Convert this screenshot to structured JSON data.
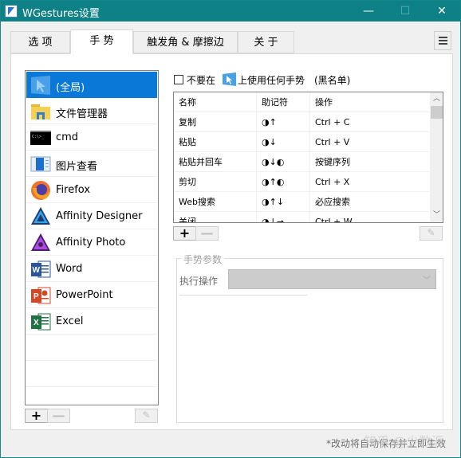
{
  "window": {
    "title": "WGestures设置",
    "controls": {
      "minimize": "—",
      "maximize": "☐",
      "close": "✕"
    }
  },
  "tabs": [
    {
      "label": "选 项",
      "active": false
    },
    {
      "label": "手 势",
      "active": true
    },
    {
      "label": "触发角 & 摩擦边",
      "active": false
    },
    {
      "label": "关 于",
      "active": false
    }
  ],
  "apps": [
    {
      "label": "(全局)",
      "icon": "global-cursor-icon",
      "selected": true
    },
    {
      "label": "文件管理器",
      "icon": "file-explorer-icon",
      "selected": false
    },
    {
      "label": "cmd",
      "icon": "cmd-icon",
      "selected": false
    },
    {
      "label": "图片查看",
      "icon": "photo-viewer-icon",
      "selected": false
    },
    {
      "label": "Firefox",
      "icon": "firefox-icon",
      "selected": false
    },
    {
      "label": "Affinity Designer",
      "icon": "affinity-designer-icon",
      "selected": false
    },
    {
      "label": "Affinity Photo",
      "icon": "affinity-photo-icon",
      "selected": false
    },
    {
      "label": "Word",
      "icon": "word-icon",
      "selected": false
    },
    {
      "label": "PowerPoint",
      "icon": "powerpoint-icon",
      "selected": false
    },
    {
      "label": "Excel",
      "icon": "excel-icon",
      "selected": false
    }
  ],
  "applist_buttons": {
    "add": "+",
    "remove": "—",
    "edit": "✎"
  },
  "blacklist": {
    "prefix": "不要在",
    "suffix": "上使用任何手势",
    "note": "(黑名单)",
    "checked": false
  },
  "gesture_table": {
    "columns": [
      "名称",
      "助记符",
      "操作"
    ],
    "rows": [
      {
        "name": "复制",
        "mnemonic": "◑↑",
        "action": "Ctrl + C"
      },
      {
        "name": "粘贴",
        "mnemonic": "◑↓",
        "action": "Ctrl + V"
      },
      {
        "name": "粘贴并回车",
        "mnemonic": "◑↓◐",
        "action": "按键序列"
      },
      {
        "name": "剪切",
        "mnemonic": "◑↑◐",
        "action": "Ctrl + X"
      },
      {
        "name": "Web搜索",
        "mnemonic": "◑↑↓",
        "action": "必应搜索"
      },
      {
        "name": "关闭",
        "mnemonic": "◑↓→",
        "action": "Ctrl + W"
      }
    ],
    "scroll_up": "︿",
    "scroll_down": "﹀"
  },
  "gesture_buttons": {
    "add": "+",
    "remove": "—",
    "edit": "✎"
  },
  "params": {
    "legend": "手势参数",
    "action_label": "执行操作",
    "action_value": "",
    "chevron": "﹀"
  },
  "footer": {
    "note": "*改动将自动保存并立即生效",
    "watermark": "知乎 @少数派"
  }
}
